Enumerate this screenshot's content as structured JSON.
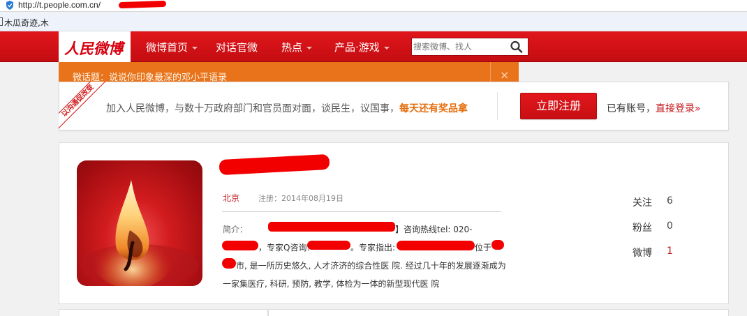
{
  "browser": {
    "url": "http://t.people.com.cn/",
    "bookmark": "木瓜奇迹,木"
  },
  "header": {
    "logo": "人民微博",
    "nav": [
      {
        "label": "微博首页",
        "dropdown": true
      },
      {
        "label": "对话官微",
        "dropdown": false
      },
      {
        "label": "热点",
        "dropdown": true
      },
      {
        "label": "产品·游戏",
        "dropdown": true
      }
    ],
    "search_placeholder": "搜索微博、找人"
  },
  "topic": {
    "text": "微话题：说说你印象最深的邓小平语录",
    "close": "×"
  },
  "register": {
    "ribbon": "以沟通促改变",
    "text": "加入人民微博，与数十万政府部门和官员面对面，谈民生，议国事，",
    "highlight": "每天还有奖品拿",
    "button": "立即注册",
    "has_account": "已有账号，",
    "login_link": "直接登录»"
  },
  "profile": {
    "location": "北京",
    "registered": "注册：2014年08月19日",
    "intro_label": "简介：",
    "intro_lines": [
      "】咨询热线tel: 020-",
      "，专家Q咨询:",
      "。专家指出:",
      "位于",
      "市, 是一所历史悠久, 人才济济的综合性医 院. 经过几十年的发展逐渐成为",
      "一家集医疗, 科研, 预防, 教学, 体检为一体的新型现代医 院"
    ],
    "stats": [
      {
        "label": "关注",
        "value": "6"
      },
      {
        "label": "粉丝",
        "value": "0"
      },
      {
        "label": "微博",
        "value": "1"
      }
    ]
  },
  "colors": {
    "brand_red": "#d6000f",
    "topic_orange": "#e8731b",
    "highlight_orange": "#e66f0f"
  }
}
